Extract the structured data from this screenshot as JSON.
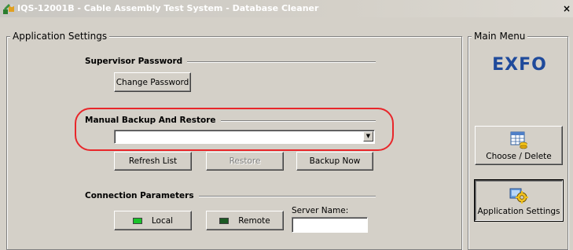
{
  "window": {
    "title": "IQS-12001B - Cable Assembly Test System - Database Cleaner",
    "close_glyph": "×"
  },
  "application_settings": {
    "legend": "Application Settings",
    "supervisor_password": {
      "heading": "Supervisor Password",
      "change_password_label": "Change Password"
    },
    "manual_backup": {
      "heading": "Manual Backup And Restore",
      "backup_select_value": "",
      "refresh_label": "Refresh List",
      "restore_label": "Restore",
      "restore_enabled": false,
      "backup_now_label": "Backup Now"
    },
    "connection": {
      "heading": "Connection Parameters",
      "local_label": "Local",
      "remote_label": "Remote",
      "server_name_label": "Server Name:",
      "server_name_value": ""
    }
  },
  "main_menu": {
    "legend": "Main Menu",
    "logo_text": "EXFO",
    "choose_delete_label": "Choose / Delete",
    "application_settings_label": "Application Settings"
  },
  "colors": {
    "highlight": "#e8262a",
    "logo": "#1f4a9b",
    "led_green": "#19c22a",
    "led_dark": "#1c5a24"
  },
  "icons": {
    "app": "app-icon",
    "choose_delete": "database-table-icon",
    "app_settings": "settings-gear-icon"
  }
}
